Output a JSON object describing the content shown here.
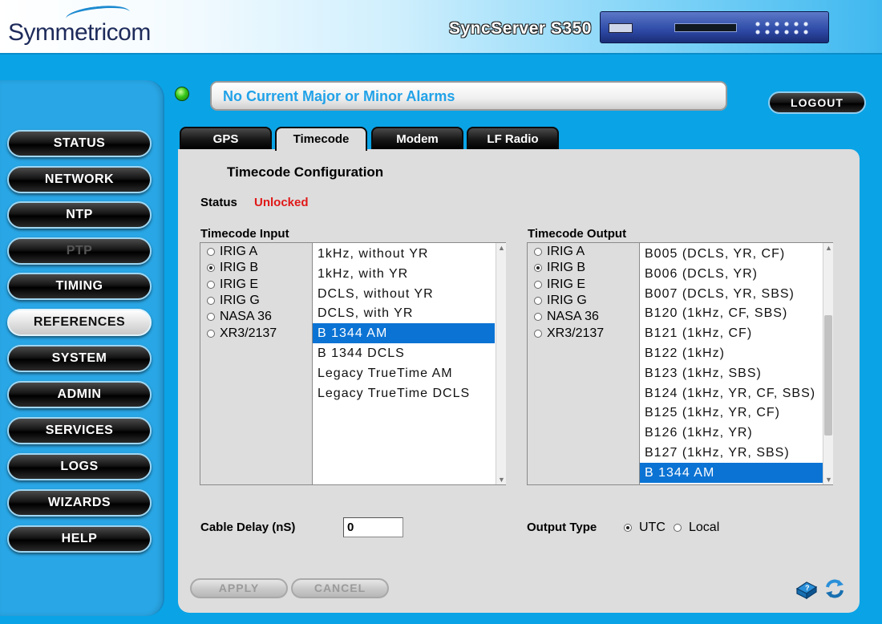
{
  "header": {
    "logo_text": "Symmetricom",
    "product_name": "SyncServer S350"
  },
  "alarm": {
    "led_color": "#35c81a",
    "message": "No Current Major or Minor Alarms"
  },
  "logout_label": "LOGOUT",
  "sidebar": {
    "items": [
      {
        "label": "STATUS",
        "state": "normal"
      },
      {
        "label": "NETWORK",
        "state": "normal"
      },
      {
        "label": "NTP",
        "state": "normal"
      },
      {
        "label": "PTP",
        "state": "disabled"
      },
      {
        "label": "TIMING",
        "state": "normal"
      },
      {
        "label": "REFERENCES",
        "state": "active"
      },
      {
        "label": "SYSTEM",
        "state": "normal"
      },
      {
        "label": "ADMIN",
        "state": "normal"
      },
      {
        "label": "SERVICES",
        "state": "normal"
      },
      {
        "label": "LOGS",
        "state": "normal"
      },
      {
        "label": "WIZARDS",
        "state": "normal"
      },
      {
        "label": "HELP",
        "state": "normal"
      }
    ]
  },
  "tabs": [
    {
      "label": "GPS",
      "active": false
    },
    {
      "label": "Timecode",
      "active": true
    },
    {
      "label": "Modem",
      "active": false
    },
    {
      "label": "LF Radio",
      "active": false
    }
  ],
  "main": {
    "title": "Timecode Configuration",
    "status_label": "Status",
    "status_value": "Unlocked",
    "status_color": "#e01818",
    "input": {
      "label": "Timecode Input",
      "formats": [
        "IRIG A",
        "IRIG B",
        "IRIG E",
        "IRIG G",
        "NASA 36",
        "XR3/2137"
      ],
      "selected_format": "IRIG B",
      "options": [
        "1kHz, without YR",
        "1kHz, with YR",
        "DCLS, without YR",
        "DCLS, with YR",
        "B 1344 AM",
        "B 1344 DCLS",
        "Legacy TrueTime AM",
        "Legacy TrueTime DCLS"
      ],
      "selected_option": "B 1344 AM"
    },
    "output": {
      "label": "Timecode Output",
      "formats": [
        "IRIG A",
        "IRIG B",
        "IRIG E",
        "IRIG G",
        "NASA 36",
        "XR3/2137"
      ],
      "selected_format": "IRIG B",
      "options": [
        "B005 (DCLS, YR, CF)",
        "B006 (DCLS, YR)",
        "B007 (DCLS, YR, SBS)",
        "B120 (1kHz, CF, SBS)",
        "B121 (1kHz, CF)",
        "B122 (1kHz)",
        "B123 (1kHz, SBS)",
        "B124 (1kHz, YR, CF, SBS)",
        "B125 (1kHz, YR, CF)",
        "B126 (1kHz, YR)",
        "B127 (1kHz, YR, SBS)",
        "B 1344 AM"
      ],
      "selected_option": "B 1344 AM"
    },
    "cable_delay_label": "Cable Delay (nS)",
    "cable_delay_value": "0",
    "output_type_label": "Output Type",
    "output_type_options": [
      "UTC",
      "Local"
    ],
    "output_type_selected": "UTC",
    "apply_label": "APPLY",
    "cancel_label": "CANCEL"
  },
  "icons": {
    "help": "help-book-icon",
    "refresh": "refresh-icon"
  }
}
